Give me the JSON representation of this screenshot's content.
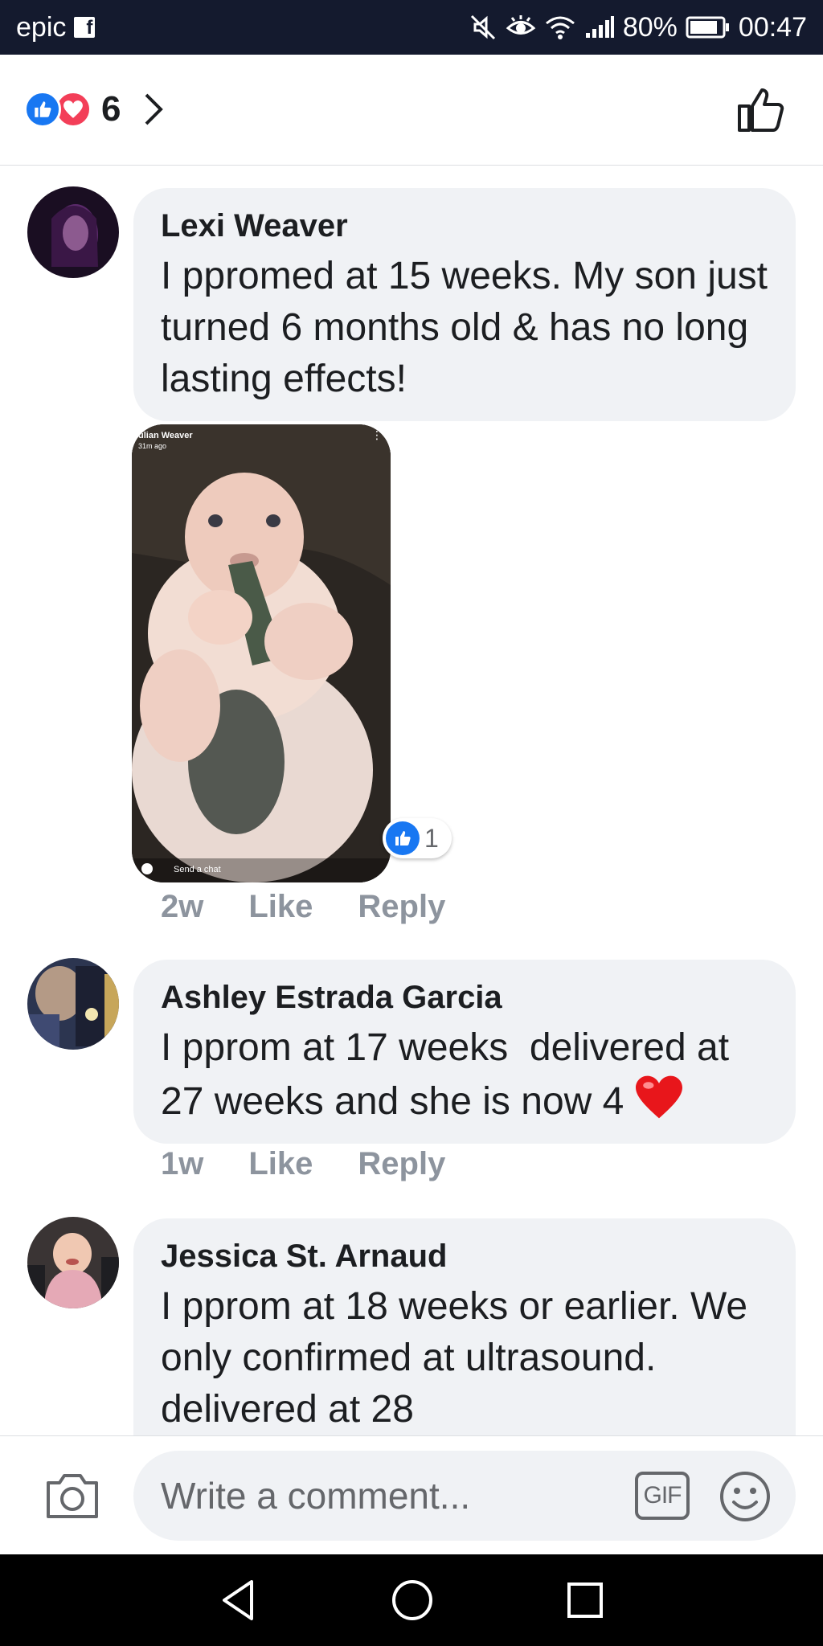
{
  "status_bar": {
    "carrier": "epic",
    "battery": "80%",
    "time": "00:47"
  },
  "reactions": {
    "count": "6",
    "types": [
      "like",
      "love"
    ]
  },
  "comments": [
    {
      "author": "Lexi Weaver",
      "text": "I ppromed at 15 weeks. My son just turned 6 months old & has no long lasting effects!",
      "attachment": {
        "name": "ulian Weaver",
        "time": "31m ago",
        "bottom_text": "Send a chat",
        "like_count": "1"
      },
      "time": "2w",
      "like_label": "Like",
      "reply_label": "Reply"
    },
    {
      "author": "Ashley Estrada Garcia",
      "text": "I pprom at 17 weeks  delivered at 27 weeks and she is now 4",
      "time": "1w",
      "like_label": "Like",
      "reply_label": "Reply"
    },
    {
      "author": "Jessica St. Arnaud",
      "text": "I pprom at 18 weeks or earlier. We only confirmed at ultrasound. delivered at 28"
    }
  ],
  "composer": {
    "placeholder": "Write a comment...",
    "gif_label": "GIF"
  },
  "colors": {
    "status_bar_bg": "#141a2e",
    "bubble_bg": "#f0f2f5",
    "like_blue": "#1877f2",
    "love_red": "#f33e58",
    "meta_gray": "#8d949e"
  },
  "icons": [
    "facebook-icon",
    "mute-icon",
    "eye-comfort-icon",
    "wifi-icon",
    "signal-icon",
    "battery-icon",
    "like-reaction-icon",
    "love-reaction-icon",
    "chevron-right-icon",
    "thumbs-up-icon",
    "heart-emoji-icon",
    "camera-icon",
    "gif-icon",
    "emoji-icon",
    "back-icon",
    "home-icon",
    "recents-icon"
  ]
}
